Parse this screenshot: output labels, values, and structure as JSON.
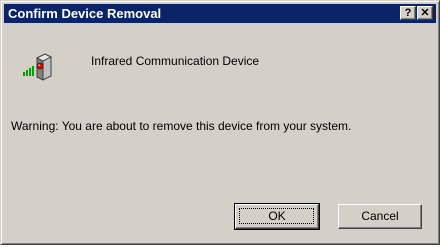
{
  "window": {
    "title": "Confirm Device Removal",
    "help_label": "?",
    "close_label": "✕"
  },
  "device": {
    "name": "Infrared Communication Device",
    "icon": "infrared-device-icon"
  },
  "message": {
    "warning": "Warning: You are about to remove this device from your system."
  },
  "buttons": {
    "ok": "OK",
    "cancel": "Cancel"
  },
  "colors": {
    "titlebar": "#0a246a",
    "face": "#d4d0c8",
    "led": "#d01010",
    "signal": "#00a000"
  }
}
